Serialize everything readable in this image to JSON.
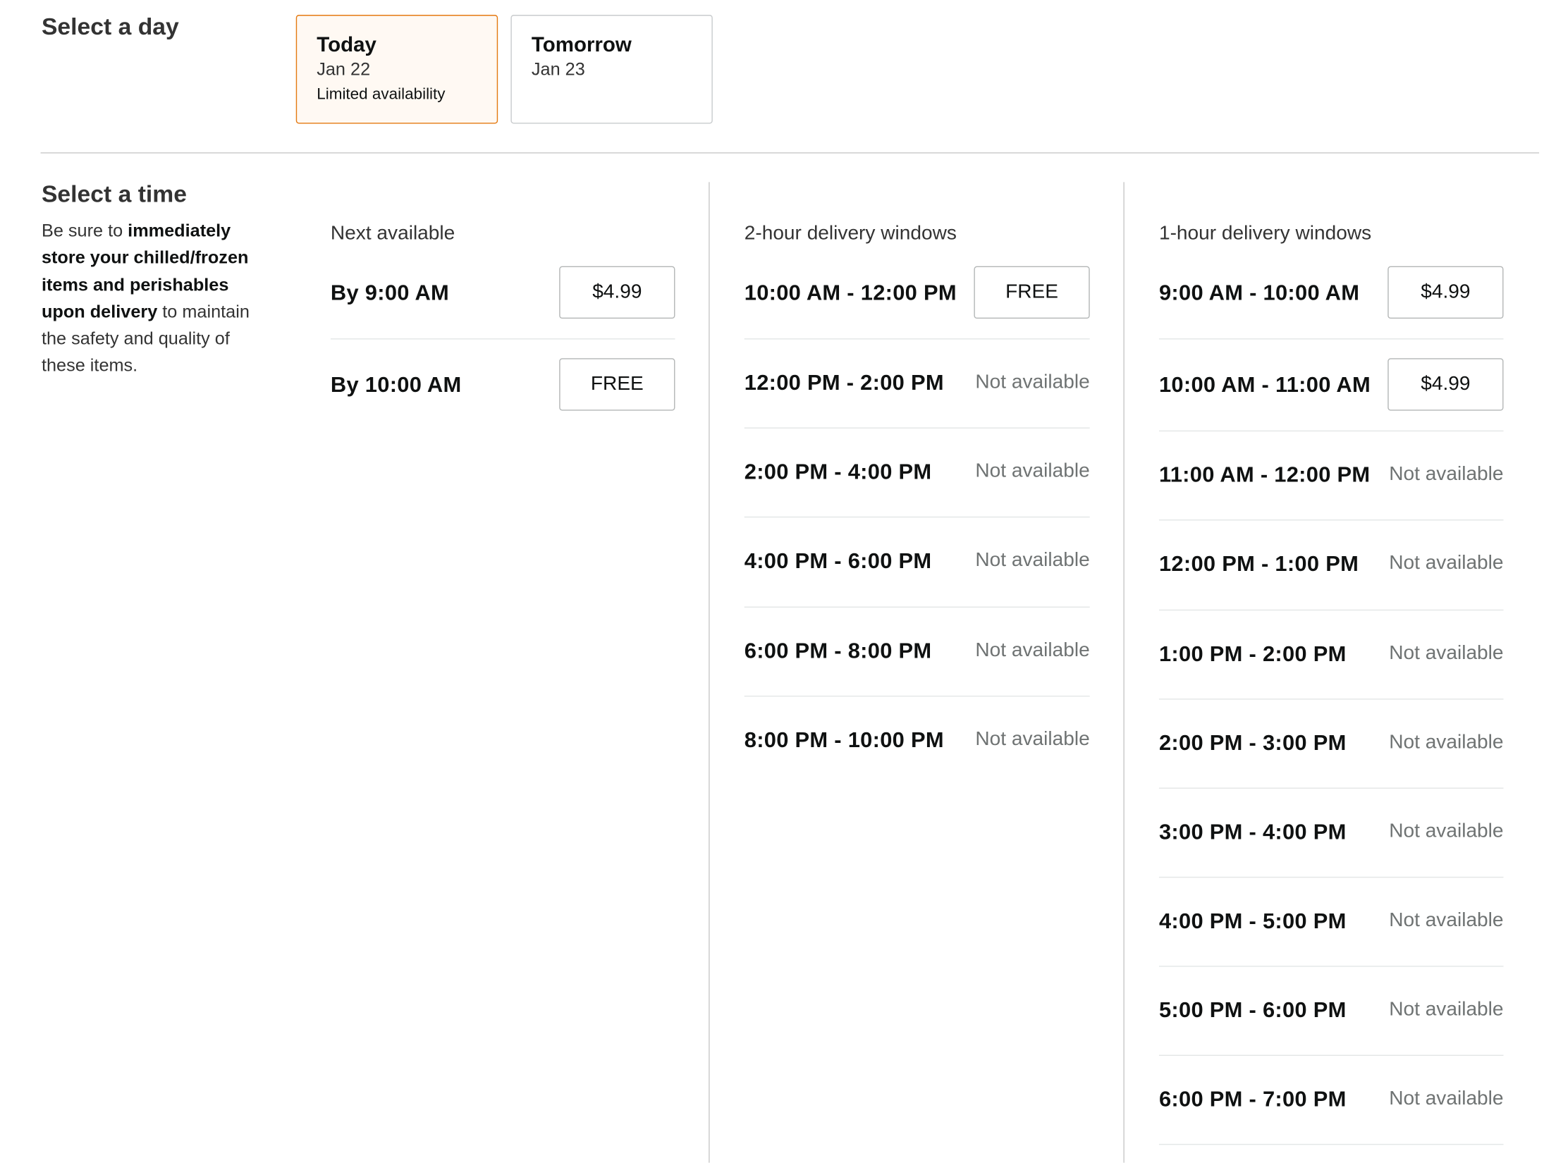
{
  "day_section": {
    "title": "Select a day",
    "days": [
      {
        "name": "Today",
        "date": "Jan 22",
        "note": "Limited availability",
        "selected": true
      },
      {
        "name": "Tomorrow",
        "date": "Jan 23",
        "note": "",
        "selected": false
      }
    ]
  },
  "time_section": {
    "title": "Select a time",
    "hint": {
      "prefix": "Be sure to ",
      "bold": "immediately store your chilled/frozen items and perishables upon delivery",
      "suffix": " to maintain the safety and quality of these items."
    },
    "columns": [
      {
        "heading": "Next available",
        "slots": [
          {
            "time": "By 9:00 AM",
            "price": "$4.99"
          },
          {
            "time": "By 10:00 AM",
            "price": "FREE"
          }
        ]
      },
      {
        "heading": "2-hour delivery windows",
        "slots": [
          {
            "time": "10:00 AM - 12:00 PM",
            "price": "FREE"
          },
          {
            "time": "12:00 PM - 2:00 PM",
            "status": "Not available"
          },
          {
            "time": "2:00 PM - 4:00 PM",
            "status": "Not available"
          },
          {
            "time": "4:00 PM - 6:00 PM",
            "status": "Not available"
          },
          {
            "time": "6:00 PM - 8:00 PM",
            "status": "Not available"
          },
          {
            "time": "8:00 PM - 10:00 PM",
            "status": "Not available"
          }
        ]
      },
      {
        "heading": "1-hour delivery windows",
        "slots": [
          {
            "time": "9:00 AM - 10:00 AM",
            "price": "$4.99"
          },
          {
            "time": "10:00 AM - 11:00 AM",
            "price": "$4.99"
          },
          {
            "time": "11:00 AM - 12:00 PM",
            "status": "Not available"
          },
          {
            "time": "12:00 PM - 1:00 PM",
            "status": "Not available"
          },
          {
            "time": "1:00 PM - 2:00 PM",
            "status": "Not available"
          },
          {
            "time": "2:00 PM - 3:00 PM",
            "status": "Not available"
          },
          {
            "time": "3:00 PM - 4:00 PM",
            "status": "Not available"
          },
          {
            "time": "4:00 PM - 5:00 PM",
            "status": "Not available"
          },
          {
            "time": "5:00 PM - 6:00 PM",
            "status": "Not available"
          },
          {
            "time": "6:00 PM - 7:00 PM",
            "status": "Not available"
          }
        ]
      }
    ]
  },
  "colors": {
    "selected_border": "#e47911",
    "text": "#0f1111",
    "muted": "#6f7373",
    "divider": "#c8c8c8"
  }
}
